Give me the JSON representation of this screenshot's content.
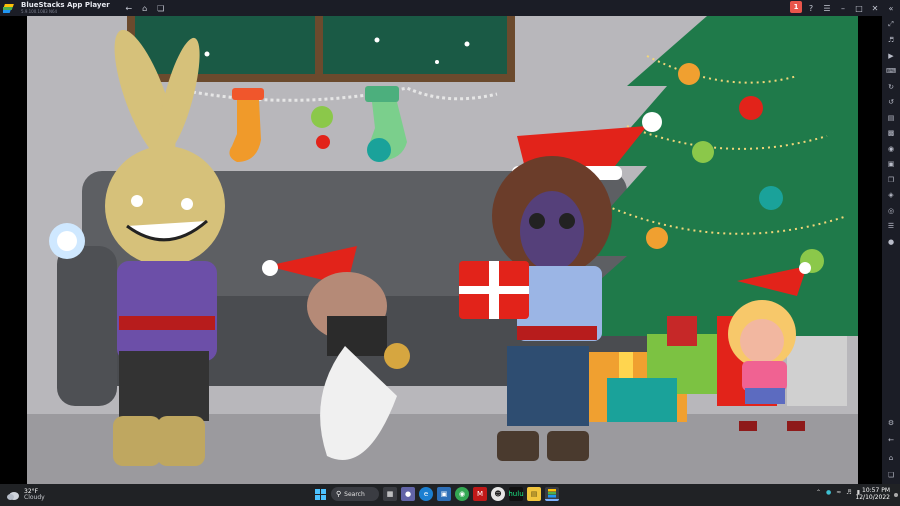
{
  "window": {
    "app_name": "BlueStacks App Player",
    "version": "5.9.100.1083 N64",
    "notification_count": "1"
  },
  "taskbar": {
    "weather_temp": "32°F",
    "weather_condition": "Cloudy",
    "search_label": "Search",
    "time": "10:57 PM",
    "date": "12/10/2022"
  },
  "scene": {
    "description_alt": "Gacha-style Christmas scene"
  },
  "colors": {
    "titlebar": "#1b1d26",
    "taskbar": "#202225",
    "wall": "#b5b4b8",
    "tree": "#1f7a4a",
    "santa_hat": "#e2231a",
    "sofa": "#5d5f63"
  }
}
